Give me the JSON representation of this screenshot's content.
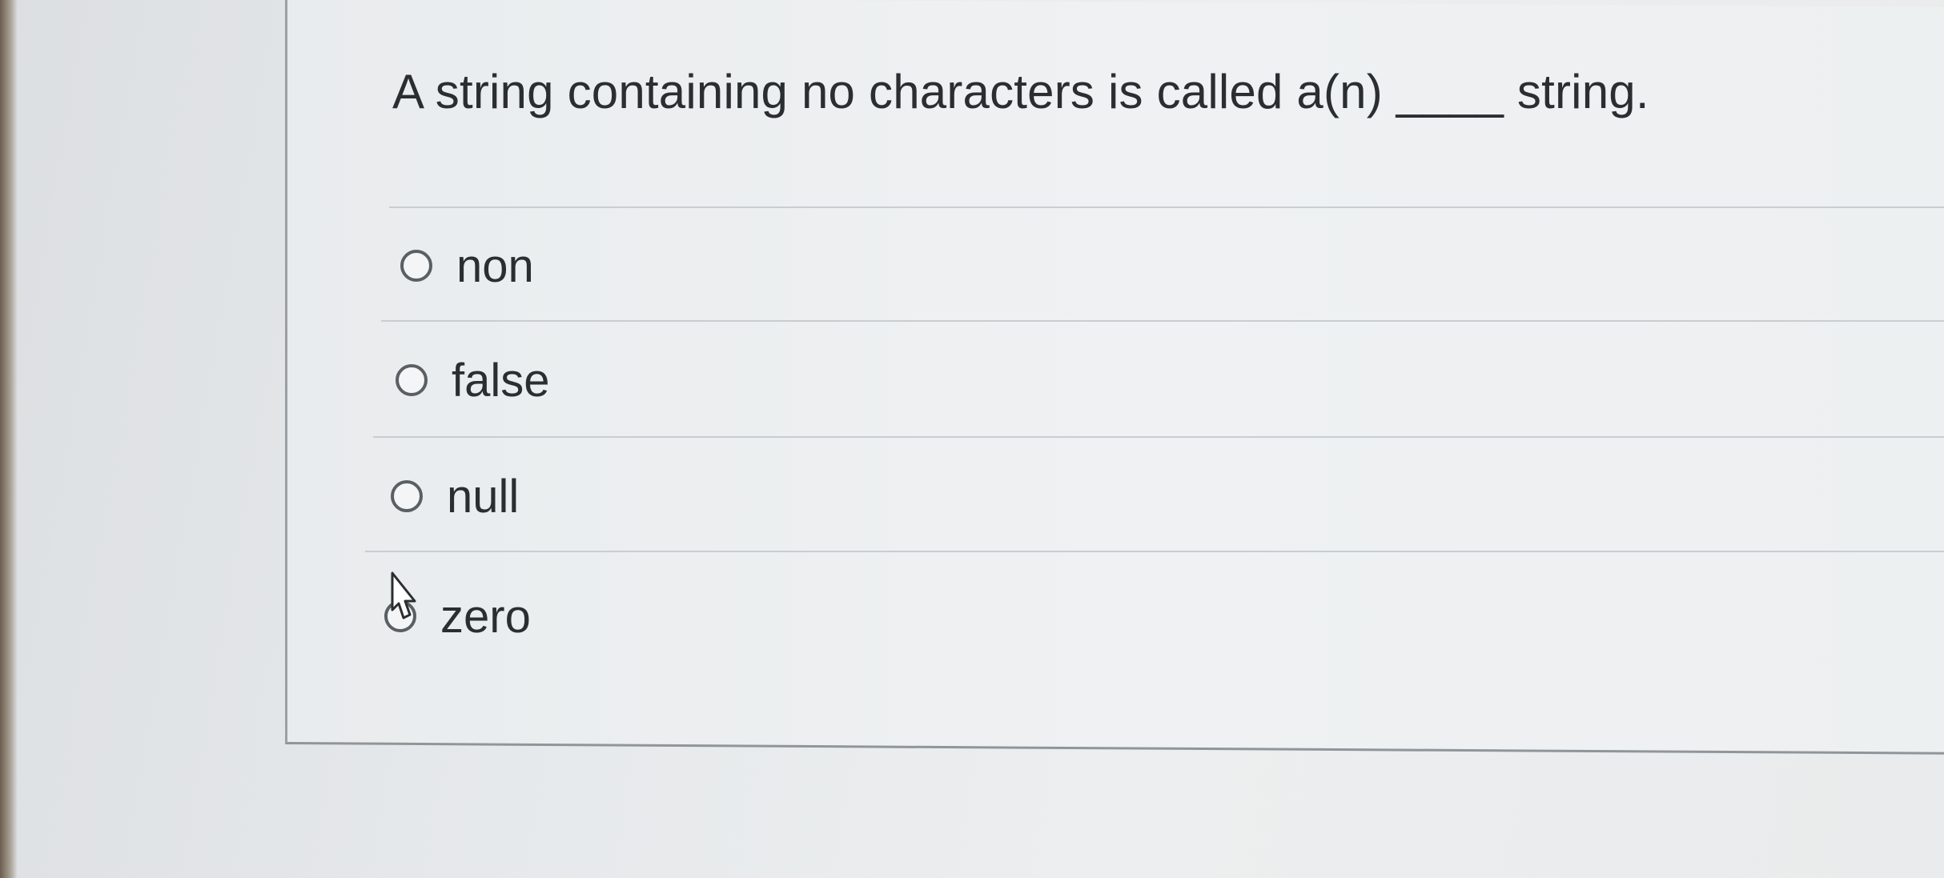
{
  "question": {
    "text": "A string containing no characters is called a(n) ____ string."
  },
  "options": [
    {
      "label": "non",
      "selected": false
    },
    {
      "label": "false",
      "selected": false
    },
    {
      "label": "null",
      "selected": false
    },
    {
      "label": "zero",
      "selected": false
    }
  ]
}
